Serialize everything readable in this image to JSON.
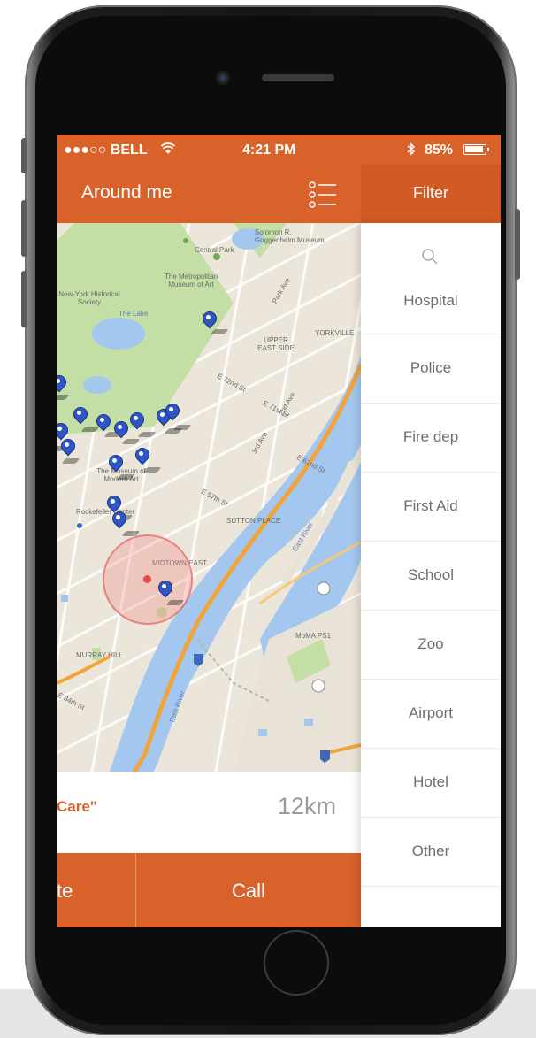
{
  "status_bar": {
    "carrier": "●●●○○ BELL",
    "time": "4:21 PM",
    "battery": "85%"
  },
  "header": {
    "title": "Around me",
    "filter_title": "Filter"
  },
  "map": {
    "labels": {
      "central_park": "Central Park",
      "guggenheim": "Solomon R. Guggenheim Museum",
      "met_museum": "The Metropolitan Museum of Art",
      "historical_society": "New-York Historical Society",
      "the_lake": "The Lake",
      "yorkville": "YORKVILLE",
      "upper_east": "UPPER EAST SIDE",
      "moma": "The Museum of Modern Art",
      "rock_center": "Rockefeller Center",
      "sutton_place": "SUTTON PLACE",
      "midtown_east": "MIDTOWN EAST",
      "murray_hill": "MURRAY HILL",
      "moma_ps1": "MoMA PS1",
      "east_river": "East River",
      "e72": "E 72nd St",
      "e71": "E 71st St",
      "e62": "E 62nd St",
      "e57": "E 57th St",
      "e34": "E 34th St",
      "park_ave": "Park Ave",
      "second_ave": "2nd Ave",
      "third_ave": "3rd Ave"
    }
  },
  "info": {
    "place": "Care\"",
    "distance": "12km"
  },
  "actions": {
    "left_label": "te",
    "call_label": "Call"
  },
  "filter": {
    "items": [
      "Hospital",
      "Police",
      "Fire dep",
      "First Aid",
      "School",
      "Zoo",
      "Airport",
      "Hotel",
      "Other"
    ]
  },
  "colors": {
    "accent": "#d9622b",
    "pin": "#2f56c7",
    "water": "#a3c7ef",
    "park": "#c4dfa6"
  }
}
